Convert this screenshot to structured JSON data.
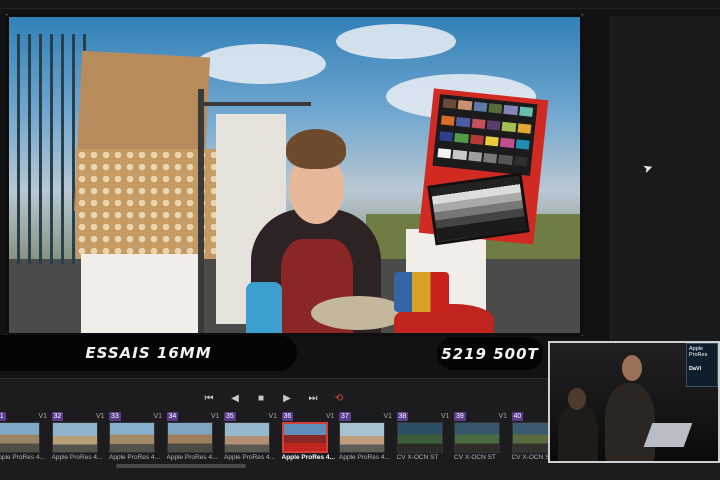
{
  "viewer": {
    "caption_left": "ESSAIS 16MM",
    "caption_right": "5219 500T",
    "chart_swatch_colors": [
      "#6b4a3a",
      "#c89071",
      "#5d7aa6",
      "#5a6b3b",
      "#8585b9",
      "#67bfab",
      "#d86d2a",
      "#4a5ba7",
      "#c5505e",
      "#5a3d6b",
      "#a2c24e",
      "#e3a733",
      "#2d3f8e",
      "#4e9c47",
      "#b63b36",
      "#e7cb3a",
      "#be4f90",
      "#1e8fb2",
      "#f2f2f2",
      "#c8c8c8",
      "#a0a0a0",
      "#797979",
      "#545454",
      "#2e2e2e"
    ]
  },
  "transport": {
    "prev_label": "⏮",
    "back_label": "◀",
    "stop_label": "■",
    "play_label": "▶",
    "next_label": "⏭",
    "loop_label": "⟲"
  },
  "clips": [
    {
      "num": "31",
      "track": "V1",
      "label": "Apple ProRes 4..."
    },
    {
      "num": "32",
      "track": "V1",
      "label": "Apple ProRes 4..."
    },
    {
      "num": "33",
      "track": "V1",
      "label": "Apple ProRes 4..."
    },
    {
      "num": "34",
      "track": "V1",
      "label": "Apple ProRes 4..."
    },
    {
      "num": "35",
      "track": "V1",
      "label": "Apple ProRes 4..."
    },
    {
      "num": "36",
      "track": "V1",
      "label": "Apple ProRes 4..."
    },
    {
      "num": "37",
      "track": "V1",
      "label": "Apple ProRes 4..."
    },
    {
      "num": "38",
      "track": "V1",
      "label": "CV X-OCN ST"
    },
    {
      "num": "39",
      "track": "V1",
      "label": "CV X-OCN ST"
    },
    {
      "num": "40",
      "track": "V1",
      "label": "CV X-OCN ST"
    }
  ],
  "pip": {
    "screen_text": "Apple ProRes",
    "screen_text_2": "DaVi"
  },
  "colors": {
    "accent_red": "#d54036",
    "clip_badge": "#5b3b8c"
  }
}
